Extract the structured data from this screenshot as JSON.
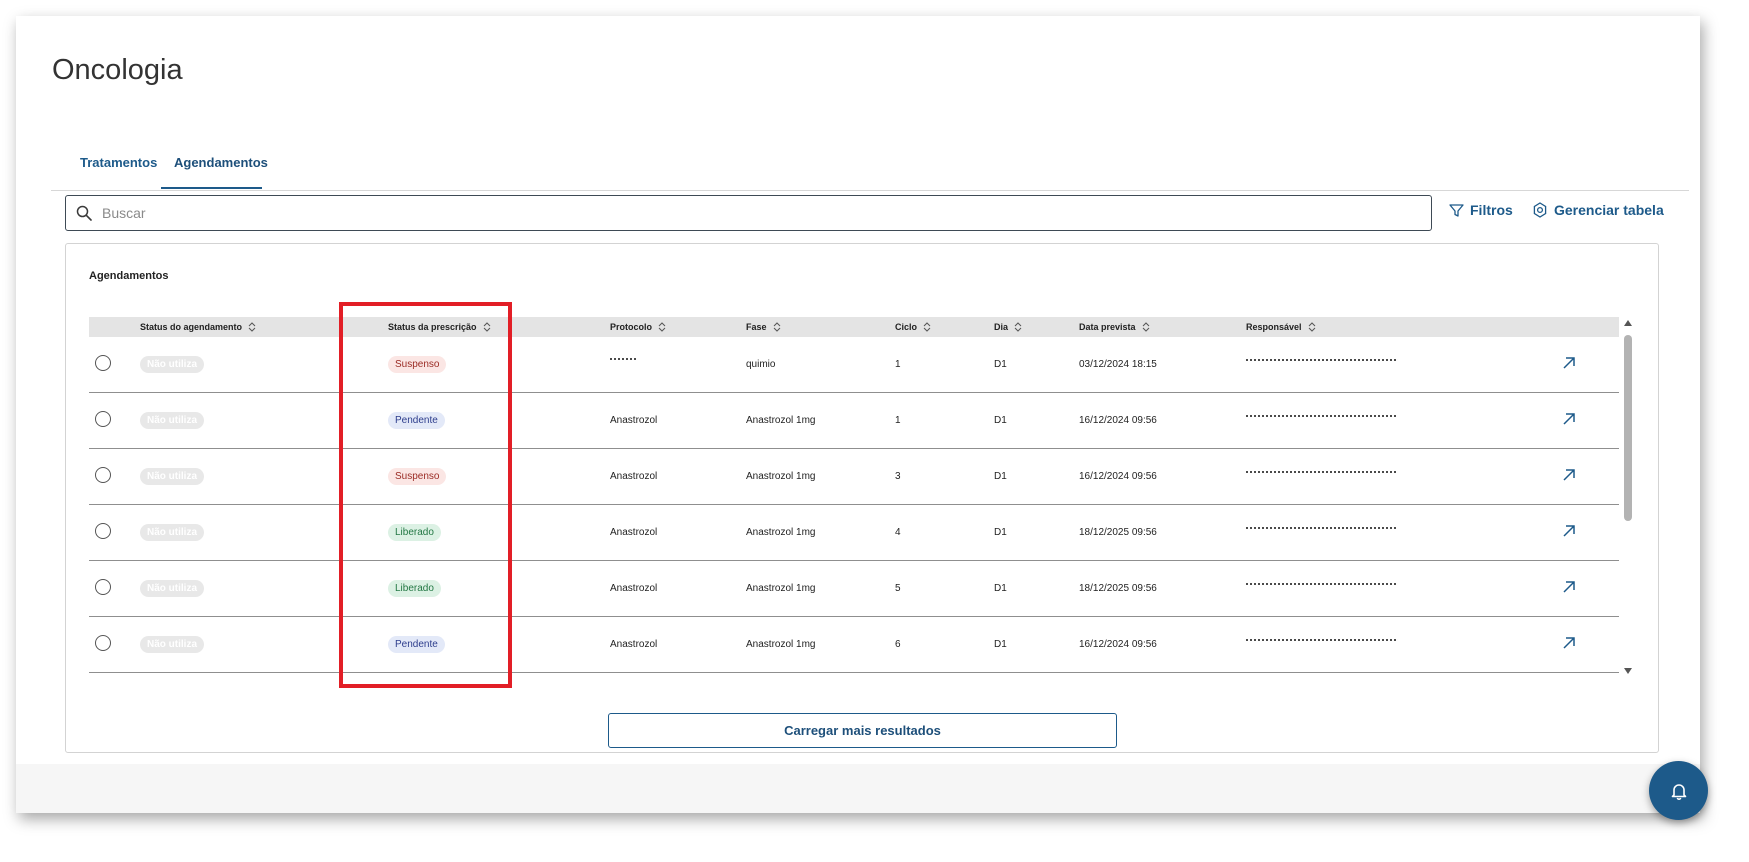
{
  "page": {
    "title": "Oncologia"
  },
  "tabs": [
    {
      "label": "Tratamentos",
      "active": false
    },
    {
      "label": "Agendamentos",
      "active": true
    }
  ],
  "search": {
    "placeholder": "Buscar",
    "value": ""
  },
  "toolbar": {
    "filters_label": "Filtros",
    "manage_table_label": "Gerenciar tabela"
  },
  "panel": {
    "title": "Agendamentos"
  },
  "table": {
    "columns": [
      "Status do agendamento",
      "Status da prescrição",
      "Protocolo",
      "Fase",
      "Ciclo",
      "Dia",
      "Data prevista",
      "Responsável"
    ],
    "rows": [
      {
        "agendamento": "Não utiliza",
        "prescricao": "Suspenso",
        "prescricao_kind": "suspenso",
        "protocolo": "",
        "fase": "quimio",
        "ciclo": "1",
        "dia": "D1",
        "data": "03/12/2024 18:15"
      },
      {
        "agendamento": "Não utiliza",
        "prescricao": "Pendente",
        "prescricao_kind": "pendente",
        "protocolo": "Anastrozol",
        "fase": "Anastrozol 1mg",
        "ciclo": "1",
        "dia": "D1",
        "data": "16/12/2024 09:56"
      },
      {
        "agendamento": "Não utiliza",
        "prescricao": "Suspenso",
        "prescricao_kind": "suspenso",
        "protocolo": "Anastrozol",
        "fase": "Anastrozol 1mg",
        "ciclo": "3",
        "dia": "D1",
        "data": "16/12/2024 09:56"
      },
      {
        "agendamento": "Não utiliza",
        "prescricao": "Liberado",
        "prescricao_kind": "liberado",
        "protocolo": "Anastrozol",
        "fase": "Anastrozol 1mg",
        "ciclo": "4",
        "dia": "D1",
        "data": "18/12/2025 09:56"
      },
      {
        "agendamento": "Não utiliza",
        "prescricao": "Liberado",
        "prescricao_kind": "liberado",
        "protocolo": "Anastrozol",
        "fase": "Anastrozol 1mg",
        "ciclo": "5",
        "dia": "D1",
        "data": "18/12/2025 09:56"
      },
      {
        "agendamento": "Não utiliza",
        "prescricao": "Pendente",
        "prescricao_kind": "pendente",
        "protocolo": "Anastrozol",
        "fase": "Anastrozol 1mg",
        "ciclo": "6",
        "dia": "D1",
        "data": "16/12/2024 09:56"
      }
    ]
  },
  "load_more": {
    "label": "Carregar mais resultados"
  },
  "icons": {
    "search": "search-icon",
    "filter": "filter-icon",
    "manage": "gear-icon",
    "sort": "sort-icon",
    "open": "arrow-up-right-icon",
    "bell": "bell-icon"
  },
  "colors": {
    "primary": "#1d5a8a",
    "highlight": "#e21e26",
    "suspenso_bg": "#fbe6e4",
    "pendente_bg": "#e3e9f8",
    "liberado_bg": "#dcf1e4"
  }
}
